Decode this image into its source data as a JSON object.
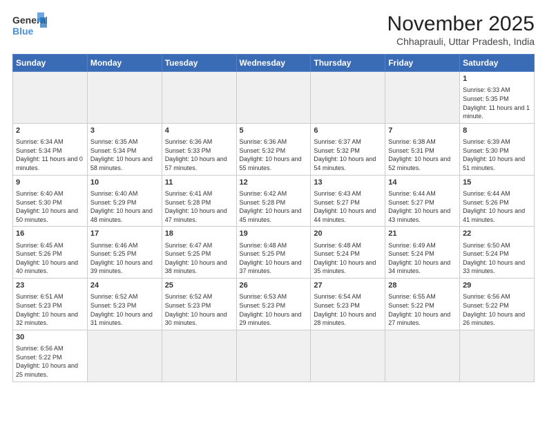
{
  "header": {
    "logo_general": "General",
    "logo_blue": "Blue",
    "month_title": "November 2025",
    "subtitle": "Chhaprauli, Uttar Pradesh, India"
  },
  "weekdays": [
    "Sunday",
    "Monday",
    "Tuesday",
    "Wednesday",
    "Thursday",
    "Friday",
    "Saturday"
  ],
  "days": [
    {
      "day": null,
      "content": null
    },
    {
      "day": null,
      "content": null
    },
    {
      "day": null,
      "content": null
    },
    {
      "day": null,
      "content": null
    },
    {
      "day": null,
      "content": null
    },
    {
      "day": null,
      "content": null
    },
    {
      "day": "1",
      "content": "Sunrise: 6:33 AM\nSunset: 5:35 PM\nDaylight: 11 hours and 1 minute."
    },
    {
      "day": "2",
      "content": "Sunrise: 6:34 AM\nSunset: 5:34 PM\nDaylight: 11 hours and 0 minutes."
    },
    {
      "day": "3",
      "content": "Sunrise: 6:35 AM\nSunset: 5:34 PM\nDaylight: 10 hours and 58 minutes."
    },
    {
      "day": "4",
      "content": "Sunrise: 6:36 AM\nSunset: 5:33 PM\nDaylight: 10 hours and 57 minutes."
    },
    {
      "day": "5",
      "content": "Sunrise: 6:36 AM\nSunset: 5:32 PM\nDaylight: 10 hours and 55 minutes."
    },
    {
      "day": "6",
      "content": "Sunrise: 6:37 AM\nSunset: 5:32 PM\nDaylight: 10 hours and 54 minutes."
    },
    {
      "day": "7",
      "content": "Sunrise: 6:38 AM\nSunset: 5:31 PM\nDaylight: 10 hours and 52 minutes."
    },
    {
      "day": "8",
      "content": "Sunrise: 6:39 AM\nSunset: 5:30 PM\nDaylight: 10 hours and 51 minutes."
    },
    {
      "day": "9",
      "content": "Sunrise: 6:40 AM\nSunset: 5:30 PM\nDaylight: 10 hours and 50 minutes."
    },
    {
      "day": "10",
      "content": "Sunrise: 6:40 AM\nSunset: 5:29 PM\nDaylight: 10 hours and 48 minutes."
    },
    {
      "day": "11",
      "content": "Sunrise: 6:41 AM\nSunset: 5:28 PM\nDaylight: 10 hours and 47 minutes."
    },
    {
      "day": "12",
      "content": "Sunrise: 6:42 AM\nSunset: 5:28 PM\nDaylight: 10 hours and 45 minutes."
    },
    {
      "day": "13",
      "content": "Sunrise: 6:43 AM\nSunset: 5:27 PM\nDaylight: 10 hours and 44 minutes."
    },
    {
      "day": "14",
      "content": "Sunrise: 6:44 AM\nSunset: 5:27 PM\nDaylight: 10 hours and 43 minutes."
    },
    {
      "day": "15",
      "content": "Sunrise: 6:44 AM\nSunset: 5:26 PM\nDaylight: 10 hours and 41 minutes."
    },
    {
      "day": "16",
      "content": "Sunrise: 6:45 AM\nSunset: 5:26 PM\nDaylight: 10 hours and 40 minutes."
    },
    {
      "day": "17",
      "content": "Sunrise: 6:46 AM\nSunset: 5:25 PM\nDaylight: 10 hours and 39 minutes."
    },
    {
      "day": "18",
      "content": "Sunrise: 6:47 AM\nSunset: 5:25 PM\nDaylight: 10 hours and 38 minutes."
    },
    {
      "day": "19",
      "content": "Sunrise: 6:48 AM\nSunset: 5:25 PM\nDaylight: 10 hours and 37 minutes."
    },
    {
      "day": "20",
      "content": "Sunrise: 6:48 AM\nSunset: 5:24 PM\nDaylight: 10 hours and 35 minutes."
    },
    {
      "day": "21",
      "content": "Sunrise: 6:49 AM\nSunset: 5:24 PM\nDaylight: 10 hours and 34 minutes."
    },
    {
      "day": "22",
      "content": "Sunrise: 6:50 AM\nSunset: 5:24 PM\nDaylight: 10 hours and 33 minutes."
    },
    {
      "day": "23",
      "content": "Sunrise: 6:51 AM\nSunset: 5:23 PM\nDaylight: 10 hours and 32 minutes."
    },
    {
      "day": "24",
      "content": "Sunrise: 6:52 AM\nSunset: 5:23 PM\nDaylight: 10 hours and 31 minutes."
    },
    {
      "day": "25",
      "content": "Sunrise: 6:52 AM\nSunset: 5:23 PM\nDaylight: 10 hours and 30 minutes."
    },
    {
      "day": "26",
      "content": "Sunrise: 6:53 AM\nSunset: 5:23 PM\nDaylight: 10 hours and 29 minutes."
    },
    {
      "day": "27",
      "content": "Sunrise: 6:54 AM\nSunset: 5:23 PM\nDaylight: 10 hours and 28 minutes."
    },
    {
      "day": "28",
      "content": "Sunrise: 6:55 AM\nSunset: 5:22 PM\nDaylight: 10 hours and 27 minutes."
    },
    {
      "day": "29",
      "content": "Sunrise: 6:56 AM\nSunset: 5:22 PM\nDaylight: 10 hours and 26 minutes."
    },
    {
      "day": "30",
      "content": "Sunrise: 6:56 AM\nSunset: 5:22 PM\nDaylight: 10 hours and 25 minutes."
    }
  ]
}
